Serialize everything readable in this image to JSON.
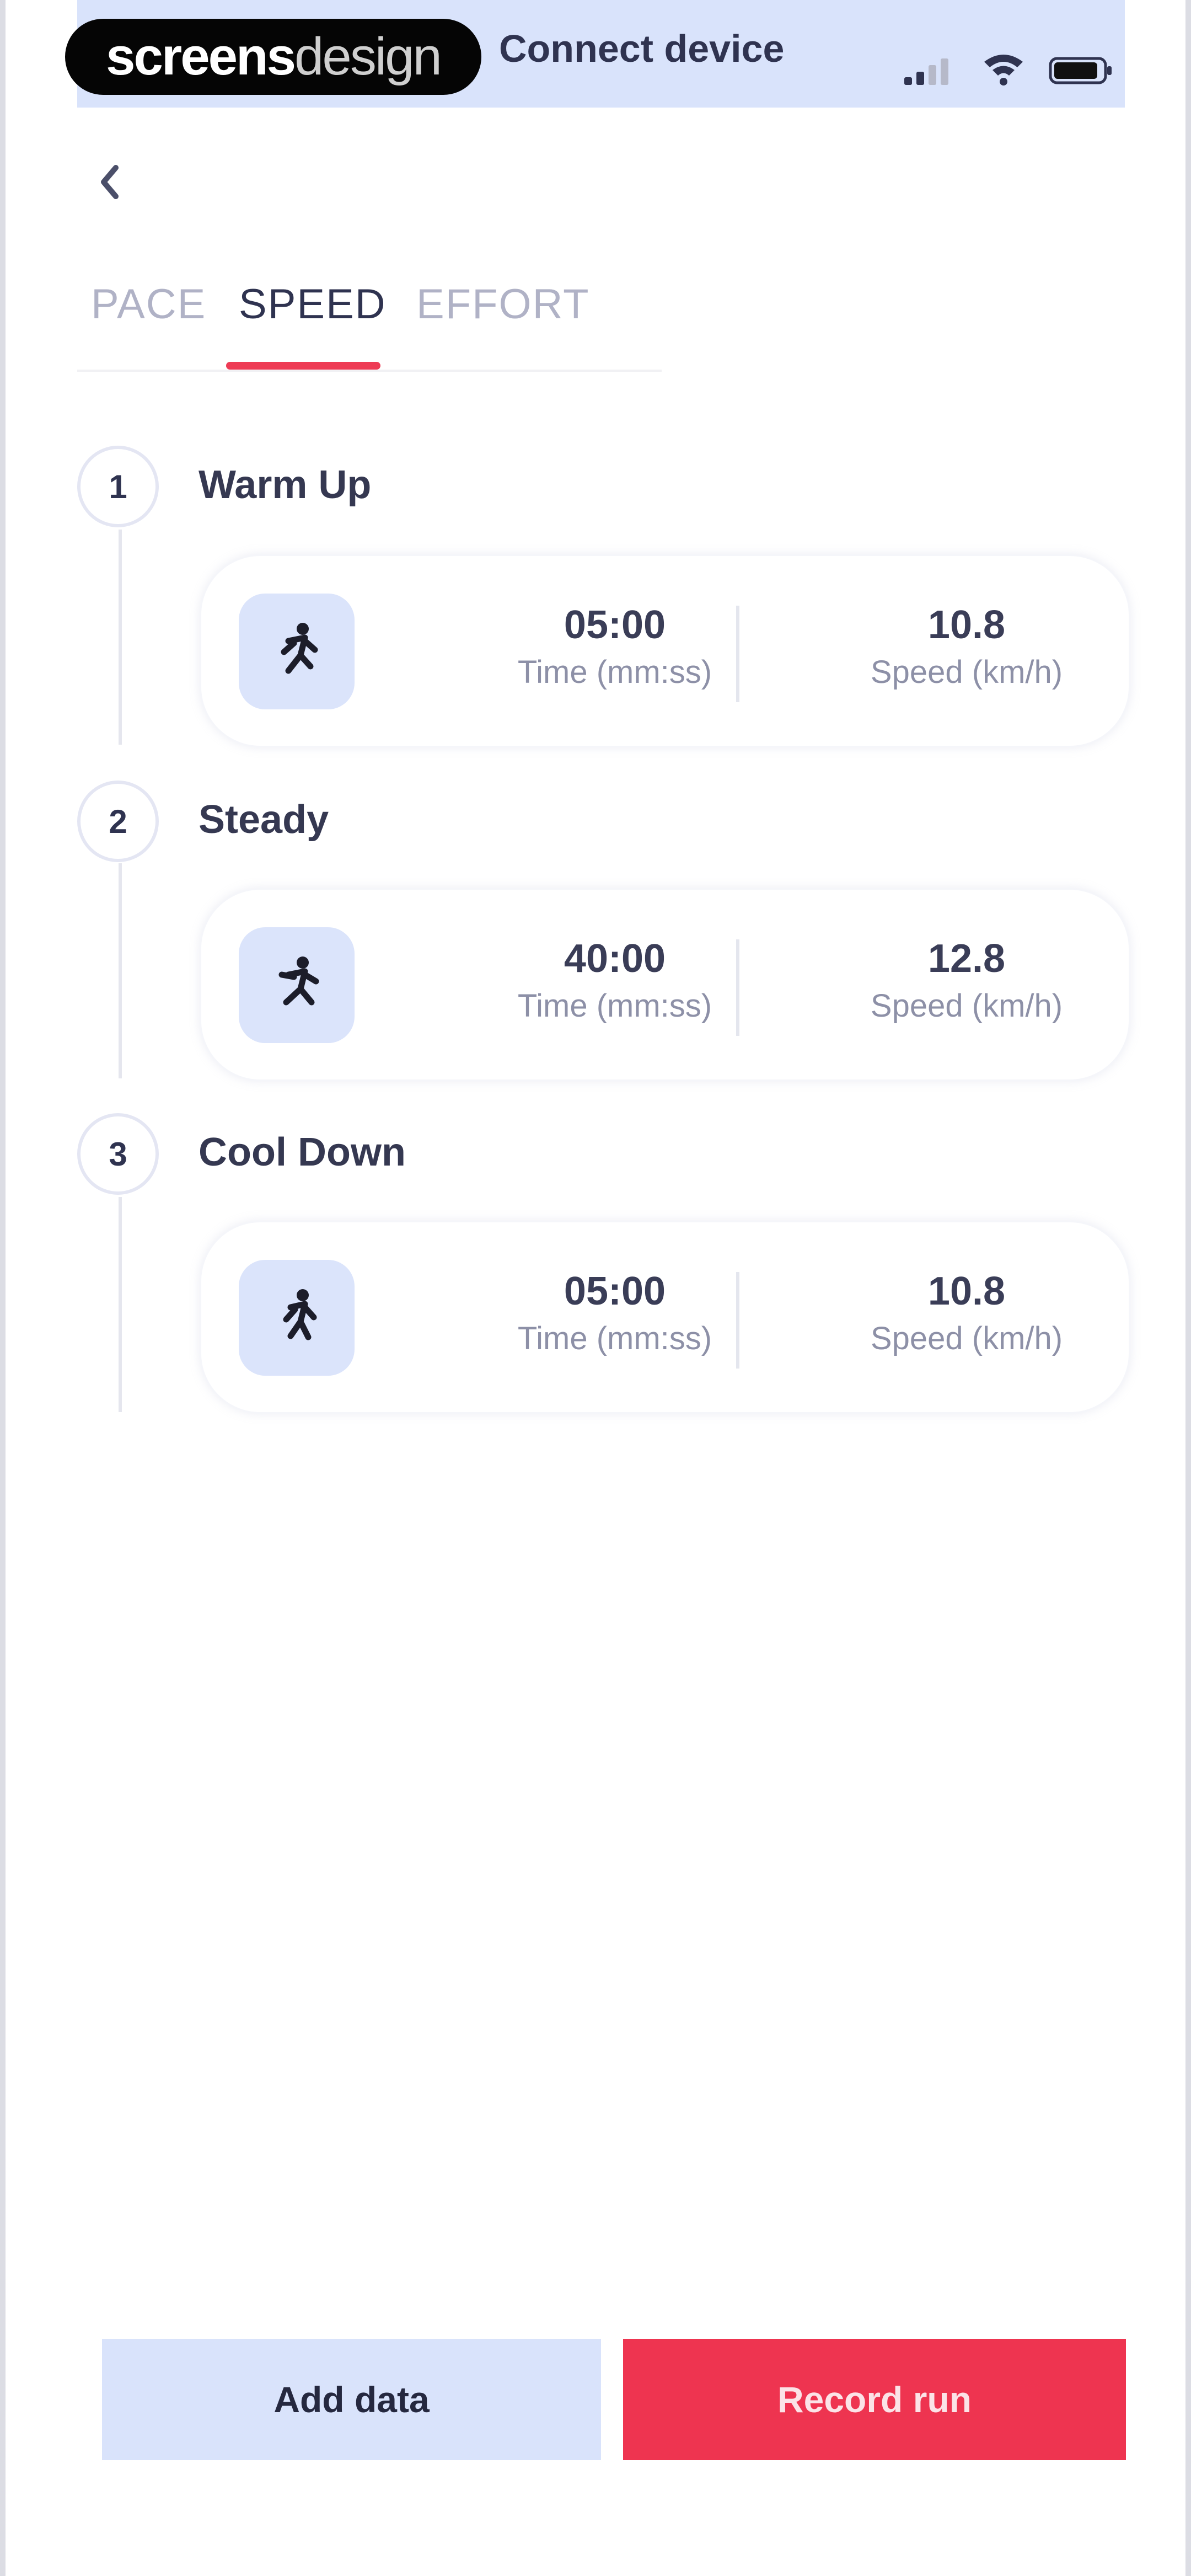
{
  "status_bar": {
    "brand_bold": "screens",
    "brand_light": "design",
    "title": "Connect device",
    "signal_icon": "signal-icon",
    "wifi_icon": "wifi-icon",
    "battery_icon": "battery-icon"
  },
  "nav": {
    "back_icon": "chevron-left-icon"
  },
  "tabs": [
    {
      "label": "PACE",
      "active": false
    },
    {
      "label": "SPEED",
      "active": true
    },
    {
      "label": "EFFORT",
      "active": false
    }
  ],
  "steps": [
    {
      "number": "1",
      "title": "Warm Up",
      "time": "05:00",
      "time_label": "Time (mm:ss)",
      "speed": "10.8",
      "speed_label": "Speed (km/h)",
      "icon": "runner-icon"
    },
    {
      "number": "2",
      "title": "Steady",
      "time": "40:00",
      "time_label": "Time (mm:ss)",
      "speed": "12.8",
      "speed_label": "Speed (km/h)",
      "icon": "runner-icon"
    },
    {
      "number": "3",
      "title": "Cool Down",
      "time": "05:00",
      "time_label": "Time (mm:ss)",
      "speed": "10.8",
      "speed_label": "Speed (km/h)",
      "icon": "runner-icon"
    }
  ],
  "actions": {
    "add_data": "Add data",
    "record_run": "Record run"
  },
  "colors": {
    "accent": "#ee3450",
    "light_blue": "#d9e3fb",
    "text_dark": "#2f3350"
  }
}
